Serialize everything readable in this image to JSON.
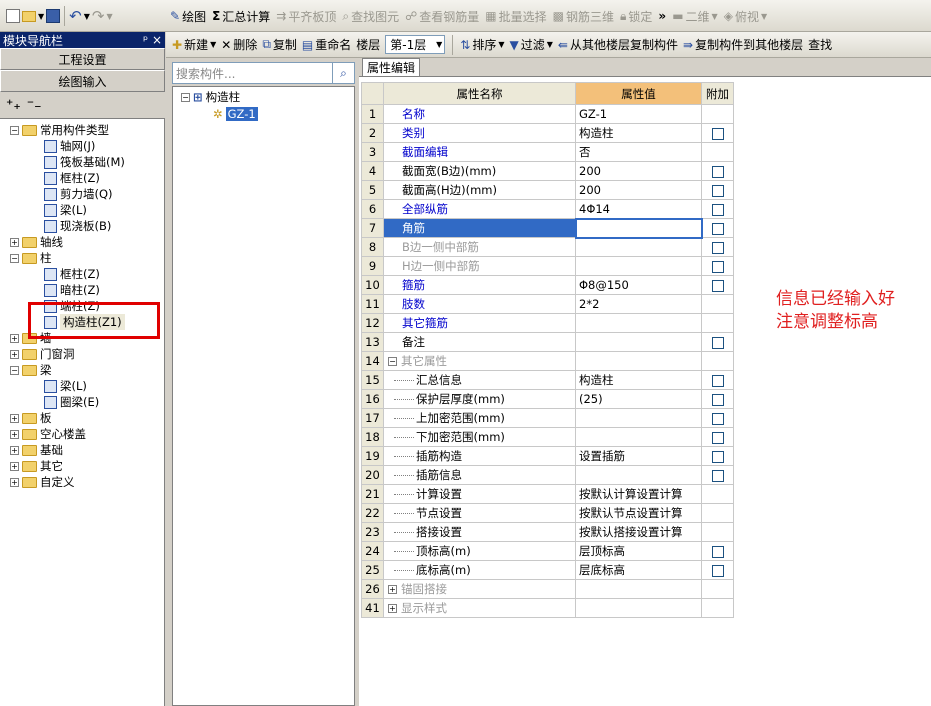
{
  "toolbar_left": {
    "items": [
      "new-icon",
      "open-icon",
      "save-icon",
      "undo-icon",
      "redo-icon"
    ]
  },
  "toolbar_main": {
    "draw": "绘图",
    "sum": "汇总计算",
    "flat_top": "平齐板顶",
    "find_elem": "查找图元",
    "view_rebar": "查看钢筋量",
    "batch_select": "批量选择",
    "rebar_3d": "钢筋三维",
    "lock": "锁定",
    "view2d": "二维",
    "plan": "俯视"
  },
  "toolbar2": {
    "new": "新建",
    "delete": "删除",
    "copy": "复制",
    "rename": "重命名",
    "floor_label": "楼层",
    "floor_value": "第-1层",
    "sort": "排序",
    "filter": "过滤",
    "copy_from": "从其他楼层复制构件",
    "copy_to": "复制构件到其他楼层",
    "find": "查找"
  },
  "nav": {
    "title": "模块导航栏",
    "pin": "ᵖ",
    "close": "×",
    "project_settings": "工程设置",
    "drawing_input": "绘图输入",
    "tree": [
      {
        "label": "常用构件类型",
        "level": 0,
        "pm": "−",
        "folder": true
      },
      {
        "label": "轴网(J)",
        "level": 1
      },
      {
        "label": "筏板基础(M)",
        "level": 1
      },
      {
        "label": "框柱(Z)",
        "level": 1
      },
      {
        "label": "剪力墙(Q)",
        "level": 1
      },
      {
        "label": "梁(L)",
        "level": 1
      },
      {
        "label": "现浇板(B)",
        "level": 1
      },
      {
        "label": "轴线",
        "level": 0,
        "pm": "+",
        "folder": true
      },
      {
        "label": "柱",
        "level": 0,
        "pm": "−",
        "folder": true
      },
      {
        "label": "框柱(Z)",
        "level": 1
      },
      {
        "label": "暗柱(Z)",
        "level": 1
      },
      {
        "label": "端柱(Z)",
        "level": 1
      },
      {
        "label": "构造柱(Z1)",
        "level": 1,
        "selected": true
      },
      {
        "label": "墙",
        "level": 0,
        "pm": "+",
        "folder": true
      },
      {
        "label": "门窗洞",
        "level": 0,
        "pm": "+",
        "folder": true
      },
      {
        "label": "梁",
        "level": 0,
        "pm": "−",
        "folder": true
      },
      {
        "label": "梁(L)",
        "level": 1
      },
      {
        "label": "圈梁(E)",
        "level": 1
      },
      {
        "label": "板",
        "level": 0,
        "pm": "+",
        "folder": true
      },
      {
        "label": "空心楼盖",
        "level": 0,
        "pm": "+",
        "folder": true
      },
      {
        "label": "基础",
        "level": 0,
        "pm": "+",
        "folder": true
      },
      {
        "label": "其它",
        "level": 0,
        "pm": "+",
        "folder": true
      },
      {
        "label": "自定义",
        "level": 0,
        "pm": "+",
        "folder": true
      }
    ]
  },
  "component_tree": {
    "search_placeholder": "搜索构件...",
    "root": "构造柱",
    "child": "GZ-1"
  },
  "props": {
    "tab": "属性编辑",
    "col_name": "属性名称",
    "col_value": "属性值",
    "col_add": "附加",
    "rows": [
      {
        "n": "1",
        "name": "名称",
        "value": "GZ-1",
        "style": "blue",
        "cb": false,
        "indent": 0
      },
      {
        "n": "2",
        "name": "类别",
        "value": "构造柱",
        "style": "blue",
        "cb": true,
        "indent": 0
      },
      {
        "n": "3",
        "name": "截面编辑",
        "value": "否",
        "style": "blue",
        "cb": false,
        "indent": 0
      },
      {
        "n": "4",
        "name": "截面宽(B边)(mm)",
        "value": "200",
        "style": "",
        "cb": true,
        "indent": 0
      },
      {
        "n": "5",
        "name": "截面高(H边)(mm)",
        "value": "200",
        "style": "",
        "cb": true,
        "indent": 0
      },
      {
        "n": "6",
        "name": "全部纵筋",
        "value": "4Φ14",
        "style": "blue",
        "cb": true,
        "indent": 0
      },
      {
        "n": "7",
        "name": "角筋",
        "value": "",
        "style": "sel",
        "cb": true,
        "indent": 0
      },
      {
        "n": "8",
        "name": "B边一侧中部筋",
        "value": "",
        "style": "gray",
        "cb": true,
        "indent": 0
      },
      {
        "n": "9",
        "name": "H边一侧中部筋",
        "value": "",
        "style": "gray",
        "cb": true,
        "indent": 0
      },
      {
        "n": "10",
        "name": "箍筋",
        "value": "Φ8@150",
        "style": "blue",
        "cb": true,
        "indent": 0
      },
      {
        "n": "11",
        "name": "肢数",
        "value": "2*2",
        "style": "blue",
        "cb": false,
        "indent": 0
      },
      {
        "n": "12",
        "name": "其它箍筋",
        "value": "",
        "style": "blue",
        "cb": false,
        "indent": 0
      },
      {
        "n": "13",
        "name": "备注",
        "value": "",
        "style": "",
        "cb": true,
        "indent": 0
      },
      {
        "n": "14",
        "name": "其它属性",
        "value": "",
        "style": "gray",
        "cb": false,
        "indent": 0,
        "pm": "−"
      },
      {
        "n": "15",
        "name": "汇总信息",
        "value": "构造柱",
        "style": "",
        "cb": true,
        "indent": 1
      },
      {
        "n": "16",
        "name": "保护层厚度(mm)",
        "value": "(25)",
        "style": "",
        "cb": true,
        "indent": 1
      },
      {
        "n": "17",
        "name": "上加密范围(mm)",
        "value": "",
        "style": "",
        "cb": true,
        "indent": 1
      },
      {
        "n": "18",
        "name": "下加密范围(mm)",
        "value": "",
        "style": "",
        "cb": true,
        "indent": 1
      },
      {
        "n": "19",
        "name": "插筋构造",
        "value": "设置插筋",
        "style": "",
        "cb": true,
        "indent": 1
      },
      {
        "n": "20",
        "name": "插筋信息",
        "value": "",
        "style": "",
        "cb": true,
        "indent": 1
      },
      {
        "n": "21",
        "name": "计算设置",
        "value": "按默认计算设置计算",
        "style": "",
        "cb": false,
        "indent": 1
      },
      {
        "n": "22",
        "name": "节点设置",
        "value": "按默认节点设置计算",
        "style": "",
        "cb": false,
        "indent": 1
      },
      {
        "n": "23",
        "name": "搭接设置",
        "value": "按默认搭接设置计算",
        "style": "",
        "cb": false,
        "indent": 1
      },
      {
        "n": "24",
        "name": "顶标高(m)",
        "value": "层顶标高",
        "style": "",
        "cb": true,
        "indent": 1
      },
      {
        "n": "25",
        "name": "底标高(m)",
        "value": "层底标高",
        "style": "",
        "cb": true,
        "indent": 1
      },
      {
        "n": "26",
        "name": "锚固搭接",
        "value": "",
        "style": "gray",
        "cb": false,
        "indent": 0,
        "pm": "+"
      },
      {
        "n": "41",
        "name": "显示样式",
        "value": "",
        "style": "gray",
        "cb": false,
        "indent": 0,
        "pm": "+"
      }
    ]
  },
  "annotation": {
    "line1": "信息已经输入好",
    "line2": "注意调整标高"
  },
  "colors": {
    "accent": "#316ac5",
    "header_value": "#f3c07a",
    "annotation": "#e02020",
    "highlight_box": "#e00000"
  }
}
